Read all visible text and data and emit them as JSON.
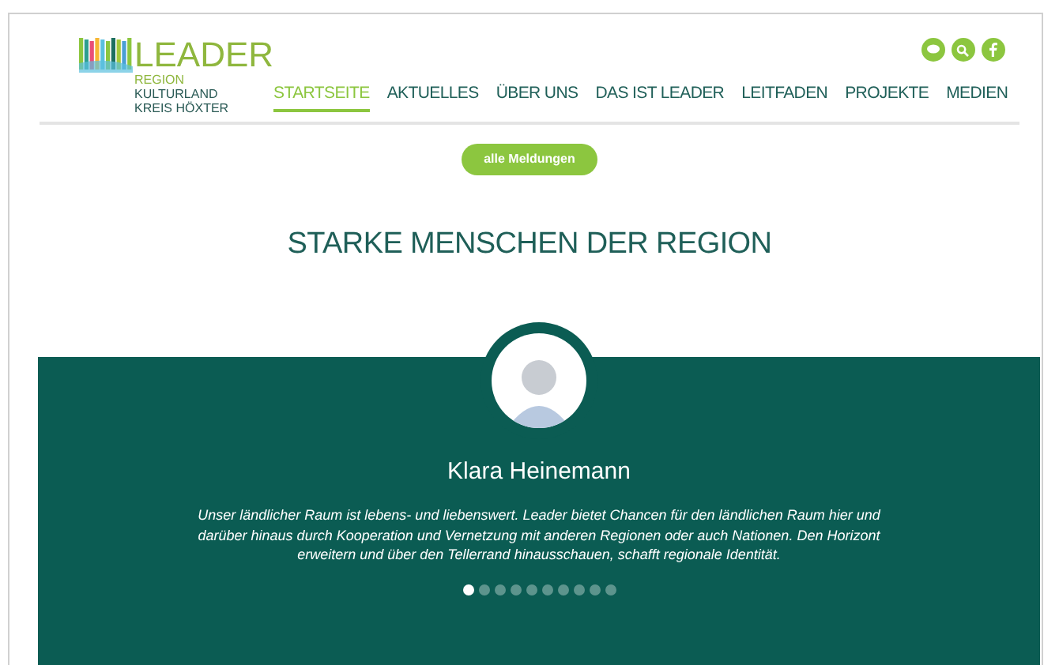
{
  "logo": {
    "title": "LEADER",
    "subtitle": "REGION",
    "lines": [
      "KULTURLAND",
      "KREIS HÖXTER"
    ]
  },
  "nav": [
    {
      "label": "STARTSEITE",
      "selected": true
    },
    {
      "label": "AKTUELLES",
      "selected": false
    },
    {
      "label": "ÜBER UNS",
      "selected": false
    },
    {
      "label": "DAS IST LEADER",
      "selected": false
    },
    {
      "label": "LEITFADEN",
      "selected": false
    },
    {
      "label": "PROJEKTE",
      "selected": false
    },
    {
      "label": "MEDIEN",
      "selected": false
    }
  ],
  "news_button": "alle Meldungen",
  "heading": "STARKE MENSCHEN DER REGION",
  "testimonial": {
    "name": "Klara Heinemann",
    "quote": "Unser ländlicher Raum ist lebens- und liebenswert. Leader bietet Chancen für den ländlichen Raum hier und darüber hinaus durch Kooperation und Vernetzung mit anderen Regionen oder auch Nationen. Den Horizont erweitern und über den Tellerrand hinausschauen, schafft regionale Identität."
  },
  "slider_dots": [
    {
      "selected": true
    },
    {
      "selected": false
    },
    {
      "selected": false
    },
    {
      "selected": false
    },
    {
      "selected": false
    },
    {
      "selected": false
    },
    {
      "selected": false
    },
    {
      "selected": false
    },
    {
      "selected": false
    },
    {
      "selected": false
    }
  ]
}
